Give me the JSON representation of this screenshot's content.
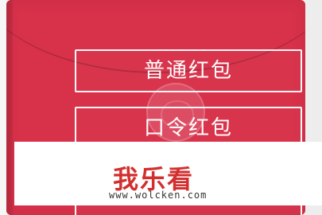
{
  "buttons": {
    "normal_red_packet": "普通红包",
    "password_red_packet": "口令红包"
  },
  "watermark": {
    "brand": "我乐看",
    "url": "www.wolcken.com"
  },
  "colors": {
    "envelope_red": "#d8314a",
    "button_text": "#ffffff",
    "brand_red": "#d32f2f"
  }
}
